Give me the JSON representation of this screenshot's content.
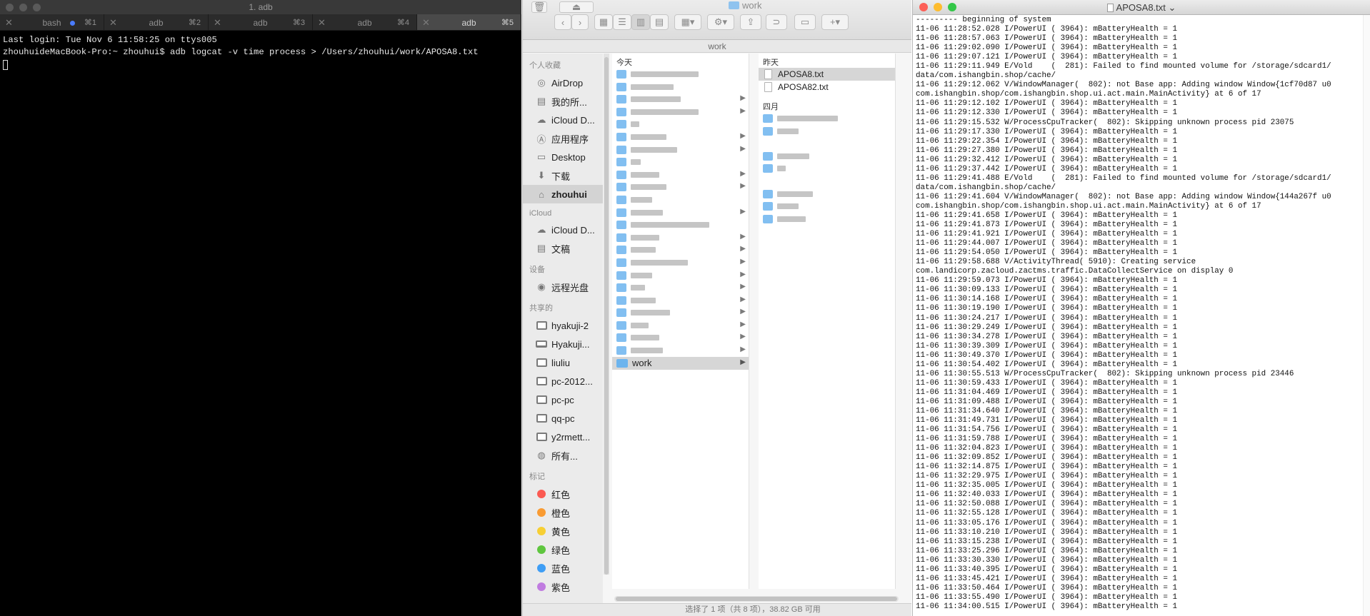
{
  "terminal": {
    "title": "1. adb",
    "tabs": [
      {
        "label": "bash",
        "key": "⌘1",
        "active": false,
        "dot": true
      },
      {
        "label": "adb",
        "key": "⌘2",
        "active": false
      },
      {
        "label": "adb",
        "key": "⌘3",
        "active": false
      },
      {
        "label": "adb",
        "key": "⌘4",
        "active": false
      },
      {
        "label": "adb",
        "key": "⌘5",
        "active": true
      }
    ],
    "lines": [
      "Last login: Tue Nov  6 11:58:25 on ttys005",
      "zhouhuideMacBook-Pro:~ zhouhui$ adb logcat -v time process > /Users/zhouhui/work/APOSA8.txt"
    ]
  },
  "finder": {
    "title": "work",
    "path": "work",
    "sidebar": {
      "sections": [
        {
          "title": "个人收藏",
          "items": [
            {
              "label": "AirDrop",
              "icon": "airdrop-icon"
            },
            {
              "label": "我的所...",
              "icon": "all-files-icon"
            },
            {
              "label": "iCloud D...",
              "icon": "cloud-icon"
            },
            {
              "label": "应用程序",
              "icon": "applications-icon"
            },
            {
              "label": "Desktop",
              "icon": "desktop-icon"
            },
            {
              "label": "下载",
              "icon": "download-icon"
            },
            {
              "label": "zhouhui",
              "icon": "home-icon",
              "active": true
            }
          ]
        },
        {
          "title": "iCloud",
          "items": [
            {
              "label": "iCloud D...",
              "icon": "cloud-icon"
            },
            {
              "label": "文稿",
              "icon": "documents-icon"
            }
          ]
        },
        {
          "title": "设备",
          "items": [
            {
              "label": "远程光盘",
              "icon": "disc-icon"
            }
          ]
        },
        {
          "title": "共享的",
          "items": [
            {
              "label": "hyakuji-2",
              "icon": "monitor-icon"
            },
            {
              "label": "Hyakuji...",
              "icon": "laptop-icon"
            },
            {
              "label": "liuliu",
              "icon": "monitor-icon"
            },
            {
              "label": "pc-2012...",
              "icon": "monitor-icon"
            },
            {
              "label": "pc-pc",
              "icon": "monitor-icon"
            },
            {
              "label": "qq-pc",
              "icon": "monitor-icon"
            },
            {
              "label": "y2rmett...",
              "icon": "monitor-icon"
            },
            {
              "label": "所有...",
              "icon": "globe-icon"
            }
          ]
        },
        {
          "title": "标记",
          "items": [
            {
              "label": "红色",
              "color": "#fb5a52"
            },
            {
              "label": "橙色",
              "color": "#f99b32"
            },
            {
              "label": "黄色",
              "color": "#f7cf34"
            },
            {
              "label": "绿色",
              "color": "#5fc63f"
            },
            {
              "label": "蓝色",
              "color": "#3f9ef5"
            },
            {
              "label": "紫色",
              "color": "#c07ce0"
            }
          ]
        }
      ]
    },
    "column1": {
      "header": "今天",
      "selected": "work"
    },
    "column2": {
      "header": "昨天",
      "files": [
        {
          "label": "APOSA8.txt",
          "selected": true
        },
        {
          "label": "APOSA82.txt",
          "selected": false
        }
      ],
      "header2": "四月"
    },
    "status": "选择了 1 项（共 8 项），38.82 GB 可用"
  },
  "textedit": {
    "title": "APOSA8.txt",
    "lines": [
      "--------- beginning of system",
      "11-06 11:28:52.028 I/PowerUI ( 3964): mBatteryHealth = 1",
      "11-06 11:28:57.063 I/PowerUI ( 3964): mBatteryHealth = 1",
      "11-06 11:29:02.090 I/PowerUI ( 3964): mBatteryHealth = 1",
      "11-06 11:29:07.121 I/PowerUI ( 3964): mBatteryHealth = 1",
      "11-06 11:29:11.949 E/Vold    (  281): Failed to find mounted volume for /storage/sdcard1/",
      "data/com.ishangbin.shop/cache/",
      "11-06 11:29:12.062 V/WindowManager(  802): not Base app: Adding window Window{1cf70d87 u0",
      "com.ishangbin.shop/com.ishangbin.shop.ui.act.main.MainActivity} at 6 of 17",
      "11-06 11:29:12.102 I/PowerUI ( 3964): mBatteryHealth = 1",
      "11-06 11:29:12.330 I/PowerUI ( 3964): mBatteryHealth = 1",
      "11-06 11:29:15.532 W/ProcessCpuTracker(  802): Skipping unknown process pid 23075",
      "11-06 11:29:17.330 I/PowerUI ( 3964): mBatteryHealth = 1",
      "11-06 11:29:22.354 I/PowerUI ( 3964): mBatteryHealth = 1",
      "11-06 11:29:27.380 I/PowerUI ( 3964): mBatteryHealth = 1",
      "11-06 11:29:32.412 I/PowerUI ( 3964): mBatteryHealth = 1",
      "11-06 11:29:37.442 I/PowerUI ( 3964): mBatteryHealth = 1",
      "11-06 11:29:41.488 E/Vold    (  281): Failed to find mounted volume for /storage/sdcard1/",
      "data/com.ishangbin.shop/cache/",
      "11-06 11:29:41.604 V/WindowManager(  802): not Base app: Adding window Window{144a267f u0",
      "com.ishangbin.shop/com.ishangbin.shop.ui.act.main.MainActivity} at 6 of 17",
      "11-06 11:29:41.658 I/PowerUI ( 3964): mBatteryHealth = 1",
      "11-06 11:29:41.873 I/PowerUI ( 3964): mBatteryHealth = 1",
      "11-06 11:29:41.921 I/PowerUI ( 3964): mBatteryHealth = 1",
      "11-06 11:29:44.007 I/PowerUI ( 3964): mBatteryHealth = 1",
      "11-06 11:29:54.050 I/PowerUI ( 3964): mBatteryHealth = 1",
      "11-06 11:29:58.688 V/ActivityThread( 5910): Creating service",
      "com.landicorp.zacloud.zactms.traffic.DataCollectService on display 0",
      "11-06 11:29:59.073 I/PowerUI ( 3964): mBatteryHealth = 1",
      "11-06 11:30:09.133 I/PowerUI ( 3964): mBatteryHealth = 1",
      "11-06 11:30:14.168 I/PowerUI ( 3964): mBatteryHealth = 1",
      "11-06 11:30:19.190 I/PowerUI ( 3964): mBatteryHealth = 1",
      "11-06 11:30:24.217 I/PowerUI ( 3964): mBatteryHealth = 1",
      "11-06 11:30:29.249 I/PowerUI ( 3964): mBatteryHealth = 1",
      "11-06 11:30:34.278 I/PowerUI ( 3964): mBatteryHealth = 1",
      "11-06 11:30:39.309 I/PowerUI ( 3964): mBatteryHealth = 1",
      "11-06 11:30:49.370 I/PowerUI ( 3964): mBatteryHealth = 1",
      "11-06 11:30:54.402 I/PowerUI ( 3964): mBatteryHealth = 1",
      "11-06 11:30:55.513 W/ProcessCpuTracker(  802): Skipping unknown process pid 23446",
      "11-06 11:30:59.433 I/PowerUI ( 3964): mBatteryHealth = 1",
      "11-06 11:31:04.469 I/PowerUI ( 3964): mBatteryHealth = 1",
      "11-06 11:31:09.488 I/PowerUI ( 3964): mBatteryHealth = 1",
      "11-06 11:31:34.640 I/PowerUI ( 3964): mBatteryHealth = 1",
      "11-06 11:31:49.731 I/PowerUI ( 3964): mBatteryHealth = 1",
      "11-06 11:31:54.756 I/PowerUI ( 3964): mBatteryHealth = 1",
      "11-06 11:31:59.788 I/PowerUI ( 3964): mBatteryHealth = 1",
      "11-06 11:32:04.823 I/PowerUI ( 3964): mBatteryHealth = 1",
      "11-06 11:32:09.852 I/PowerUI ( 3964): mBatteryHealth = 1",
      "11-06 11:32:14.875 I/PowerUI ( 3964): mBatteryHealth = 1",
      "11-06 11:32:29.975 I/PowerUI ( 3964): mBatteryHealth = 1",
      "11-06 11:32:35.005 I/PowerUI ( 3964): mBatteryHealth = 1",
      "11-06 11:32:40.033 I/PowerUI ( 3964): mBatteryHealth = 1",
      "11-06 11:32:50.088 I/PowerUI ( 3964): mBatteryHealth = 1",
      "11-06 11:32:55.128 I/PowerUI ( 3964): mBatteryHealth = 1",
      "11-06 11:33:05.176 I/PowerUI ( 3964): mBatteryHealth = 1",
      "11-06 11:33:10.210 I/PowerUI ( 3964): mBatteryHealth = 1",
      "11-06 11:33:15.238 I/PowerUI ( 3964): mBatteryHealth = 1",
      "11-06 11:33:25.296 I/PowerUI ( 3964): mBatteryHealth = 1",
      "11-06 11:33:30.330 I/PowerUI ( 3964): mBatteryHealth = 1",
      "11-06 11:33:40.395 I/PowerUI ( 3964): mBatteryHealth = 1",
      "11-06 11:33:45.421 I/PowerUI ( 3964): mBatteryHealth = 1",
      "11-06 11:33:50.464 I/PowerUI ( 3964): mBatteryHealth = 1",
      "11-06 11:33:55.490 I/PowerUI ( 3964): mBatteryHealth = 1",
      "11-06 11:34:00.515 I/PowerUI ( 3964): mBatteryHealth = 1"
    ]
  },
  "colors": {
    "terminal_bg": "#000000",
    "traffic_red": "#fc5f57",
    "traffic_yellow": "#fdbc2e",
    "traffic_green": "#33c748",
    "folder_blue": "#6cb4ee"
  }
}
